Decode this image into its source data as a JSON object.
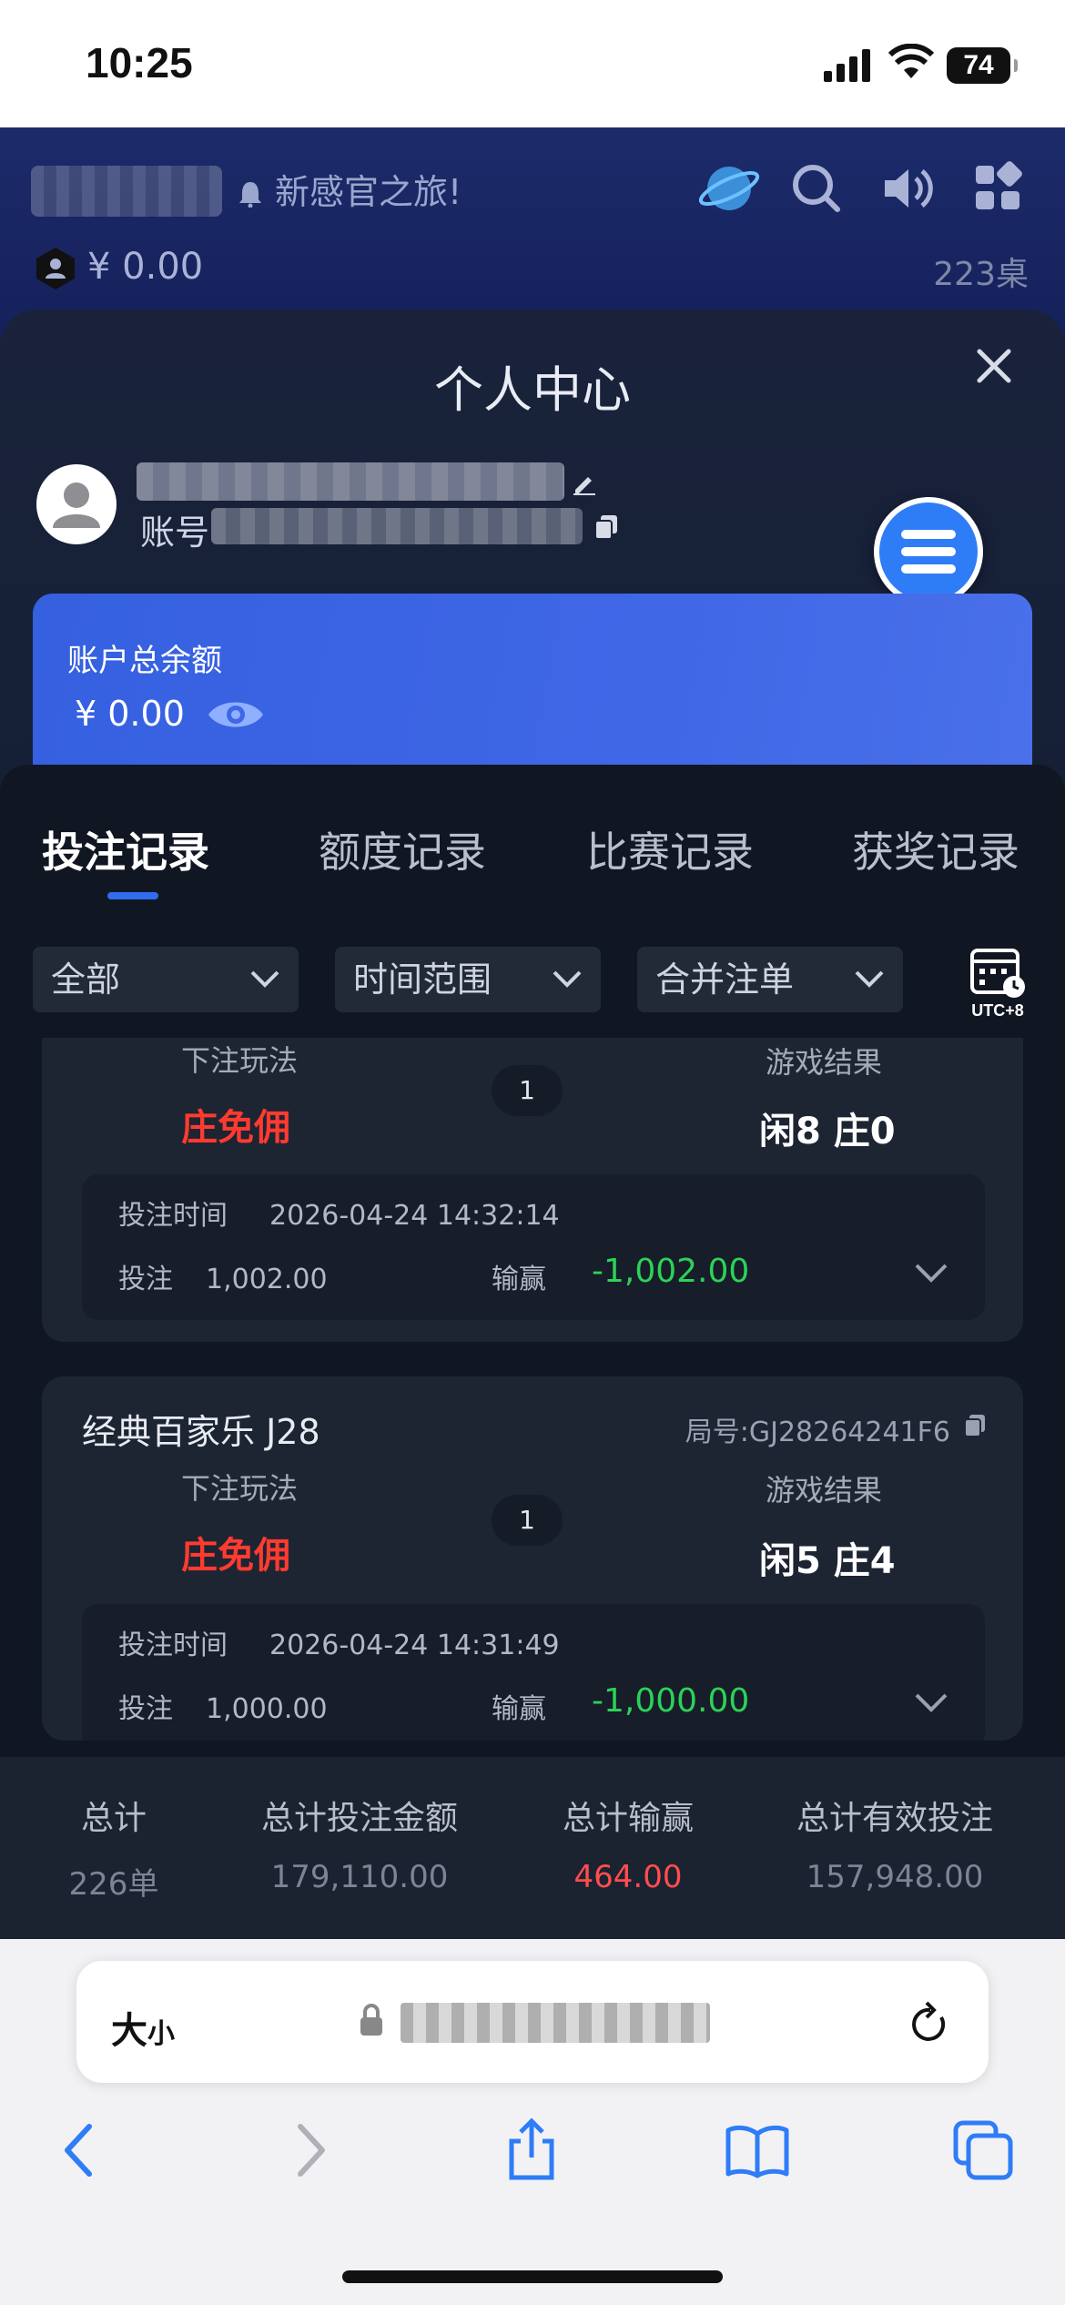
{
  "status_bar": {
    "time": "10:25",
    "battery": "74"
  },
  "header": {
    "notice": "新感官之旅!",
    "balance": "¥ 0.00",
    "tables": "223桌"
  },
  "modal": {
    "title": "个人中心",
    "account_label": "账号",
    "balance_card": {
      "label": "账户总余额",
      "amount": "¥ 0.00"
    }
  },
  "tabs": [
    {
      "label": "投注记录",
      "active": true
    },
    {
      "label": "额度记录",
      "active": false
    },
    {
      "label": "比赛记录",
      "active": false
    },
    {
      "label": "获奖记录",
      "active": false
    }
  ],
  "filters": {
    "all": "全部",
    "time_range": "时间范围",
    "merge": "合并注单",
    "timezone": "UTC+8"
  },
  "labels": {
    "bet_play": "下注玩法",
    "game_result": "游戏结果",
    "bet_time": "投注时间",
    "bet": "投注",
    "win_loss": "输赢"
  },
  "records": [
    {
      "bet_type": "庄免佣",
      "count": "1",
      "result": "闲8 庄0",
      "bet_time": "2026-04-24 14:32:14",
      "amount": "1,002.00",
      "win_loss": "-1,002.00"
    },
    {
      "title": "经典百家乐 J28",
      "round_id": "局号:GJ28264241F6",
      "bet_type": "庄免佣",
      "count": "1",
      "result": "闲5 庄4",
      "bet_time": "2026-04-24 14:31:49",
      "amount": "1,000.00",
      "win_loss": "-1,000.00"
    }
  ],
  "summary": [
    {
      "title": "总计",
      "value": "226单"
    },
    {
      "title": "总计投注金额",
      "value": "179,110.00"
    },
    {
      "title": "总计输赢",
      "value": "464.00"
    },
    {
      "title": "总计有效投注",
      "value": "157,948.00"
    }
  ],
  "safari": {
    "aa_big": "大",
    "aa_small": "小"
  },
  "colors": {
    "accent": "#2f6cf0",
    "loss": "#2bd257",
    "bet_type": "#ff3b30",
    "total_win": "#ff4d4f"
  }
}
